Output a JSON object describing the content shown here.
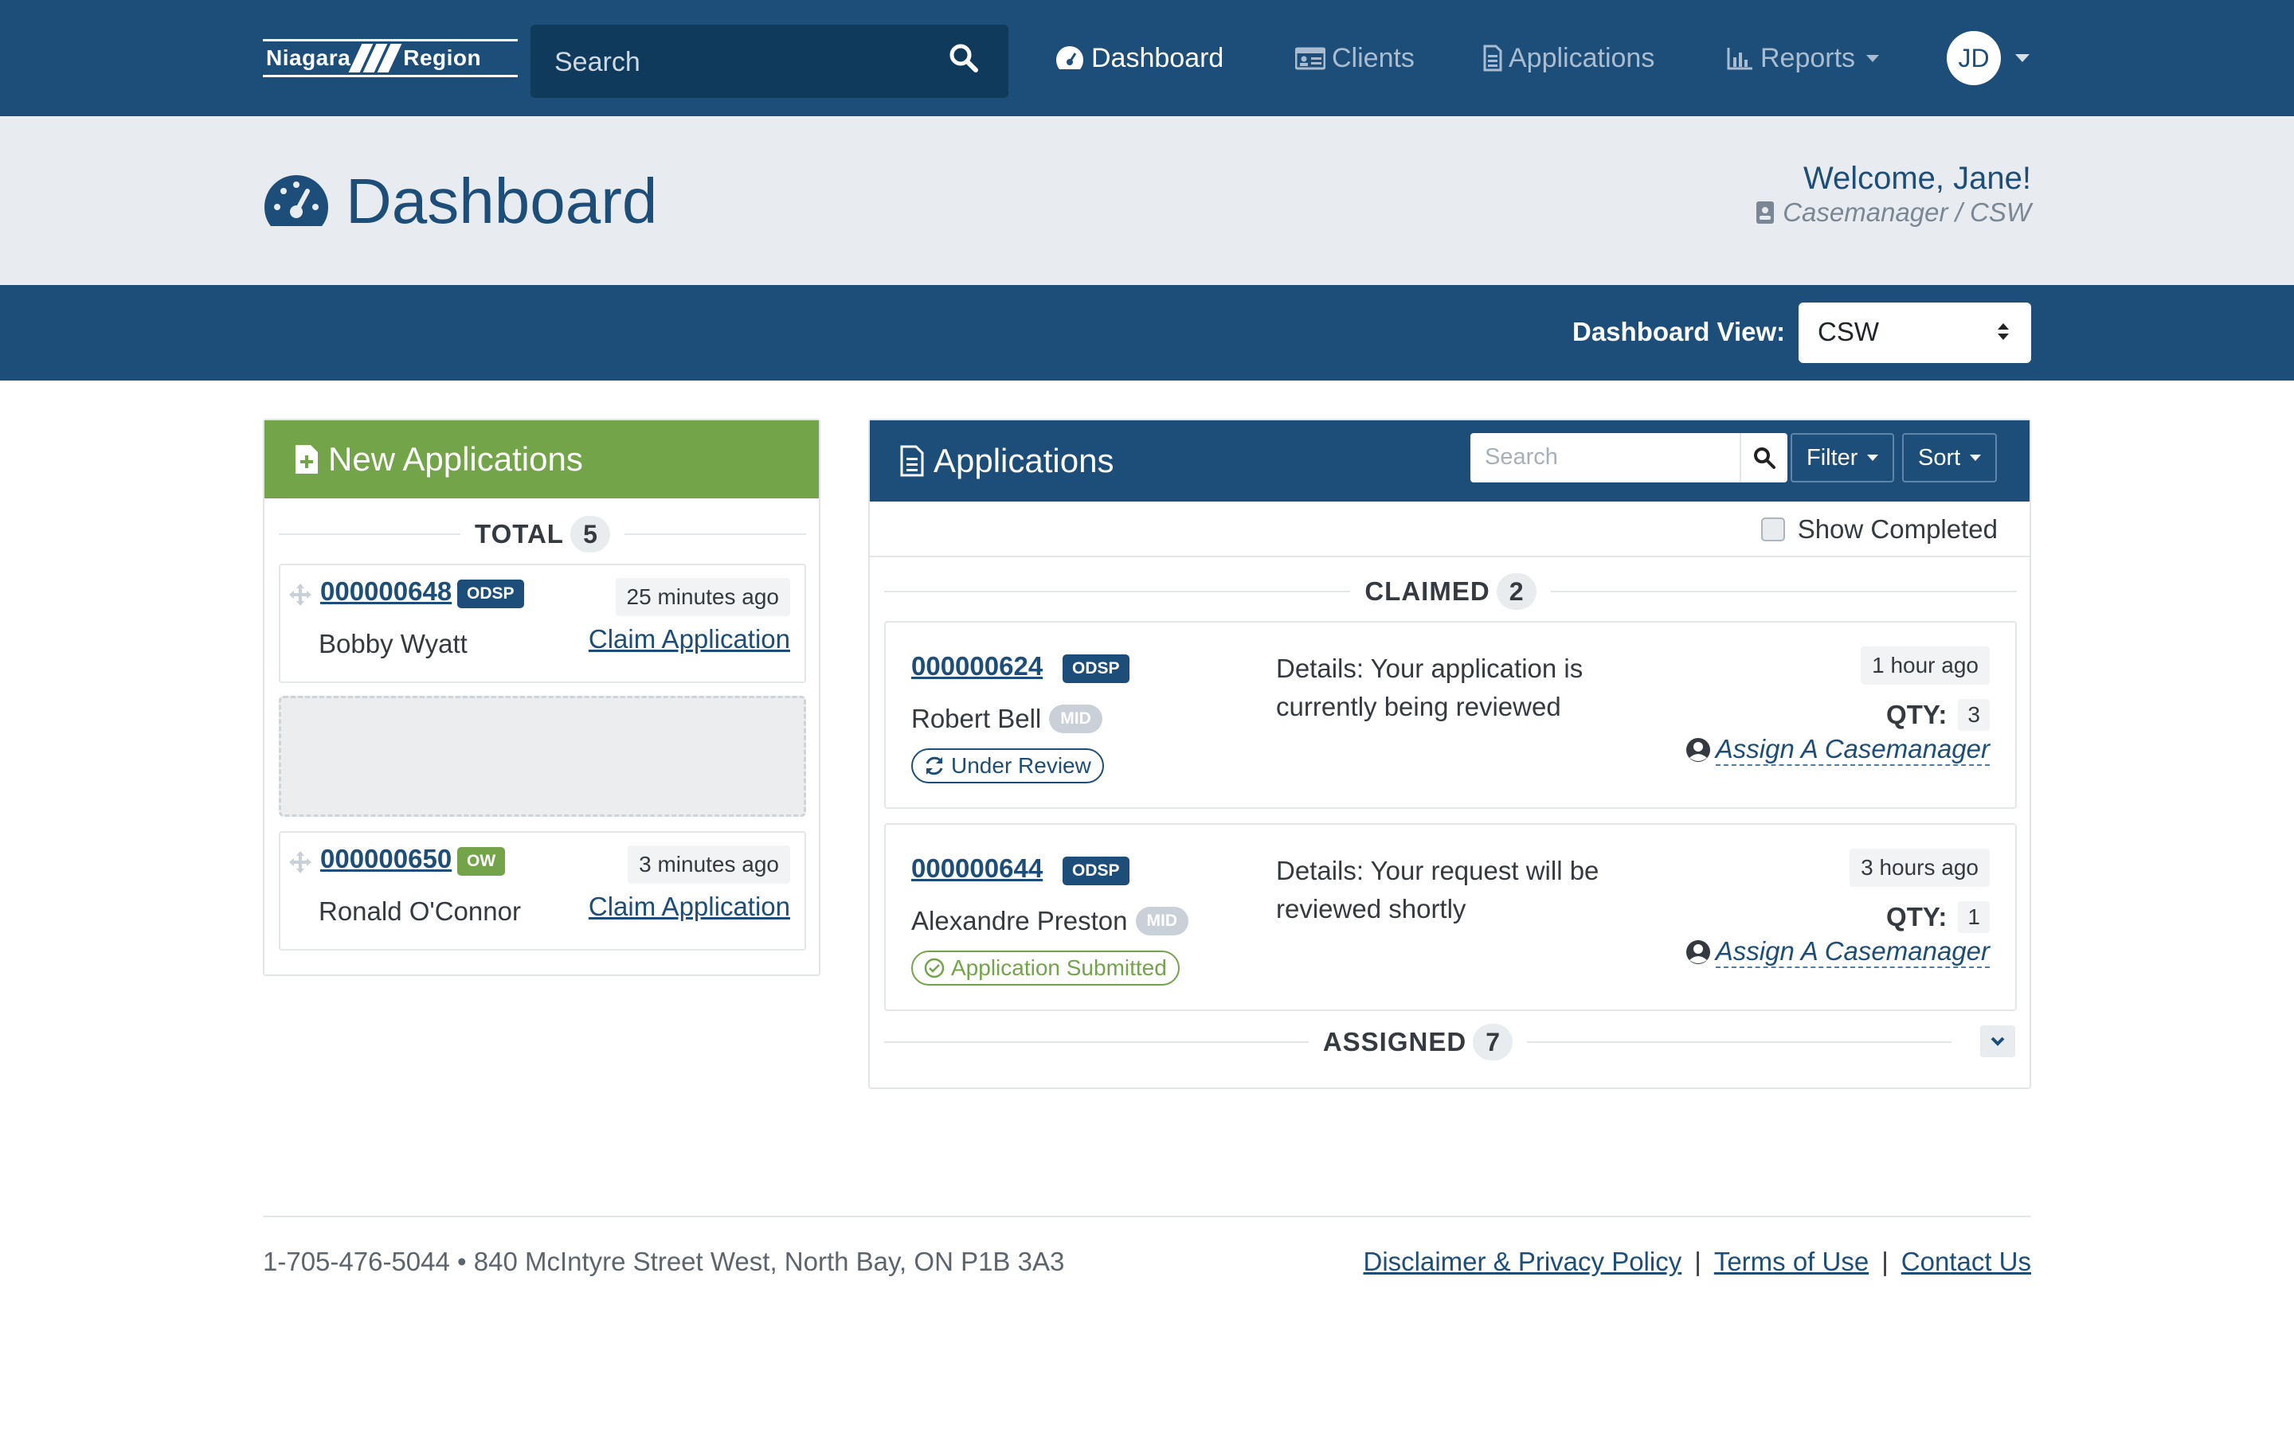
{
  "nav": {
    "logo_left": "Niagara",
    "logo_right": "Region",
    "search_placeholder": "Search",
    "items": [
      {
        "label": "Dashboard",
        "icon": "tachometer-icon"
      },
      {
        "label": "Clients",
        "icon": "id-card-icon"
      },
      {
        "label": "Applications",
        "icon": "document-icon"
      },
      {
        "label": "Reports",
        "icon": "bar-chart-icon"
      }
    ],
    "avatar_initials": "JD"
  },
  "header": {
    "title": "Dashboard",
    "welcome": "Welcome, Jane!",
    "role": "Casemanager / CSW"
  },
  "view": {
    "label": "Dashboard View:",
    "selected": "CSW"
  },
  "new_applications": {
    "title": "New Applications",
    "total_label": "TOTAL",
    "total_count": "5",
    "cards": [
      {
        "id": "000000648",
        "program": "ODSP",
        "time": "25 minutes ago",
        "name": "Bobby Wyatt",
        "action": "Claim Application"
      },
      {
        "id": "000000650",
        "program": "OW",
        "time": "3 minutes ago",
        "name": "Ronald O'Connor",
        "action": "Claim Application"
      }
    ]
  },
  "applications": {
    "title": "Applications",
    "search_placeholder": "Search",
    "filter_label": "Filter",
    "sort_label": "Sort",
    "show_completed_label": "Show Completed",
    "claimed_label": "CLAIMED",
    "claimed_count": "2",
    "assigned_label": "ASSIGNED",
    "assigned_count": "7",
    "cards": [
      {
        "id": "000000624",
        "program": "ODSP",
        "name": "Robert Bell",
        "tier": "MID",
        "status": "Under Review",
        "details": "Details: Your application is currently being reviewed",
        "time": "1 hour ago",
        "qty_label": "QTY:",
        "qty": "3",
        "assign": "Assign A Casemanager"
      },
      {
        "id": "000000644",
        "program": "ODSP",
        "name": "Alexandre Preston",
        "tier": "MID",
        "status": "Application Submitted",
        "details": "Details: Your request will be reviewed shortly",
        "time": "3 hours ago",
        "qty_label": "QTY:",
        "qty": "1",
        "assign": "Assign A Casemanager"
      }
    ]
  },
  "footer": {
    "address": "1-705-476-5044 • 840 McIntyre Street West, North Bay, ON P1B 3A3",
    "links": [
      "Disclaimer & Privacy Policy",
      "Terms of Use",
      "Contact Us"
    ],
    "separator": "|"
  },
  "colors": {
    "primary": "#1d4e79",
    "success": "#74a449",
    "header_band": "#e8ecf0"
  }
}
